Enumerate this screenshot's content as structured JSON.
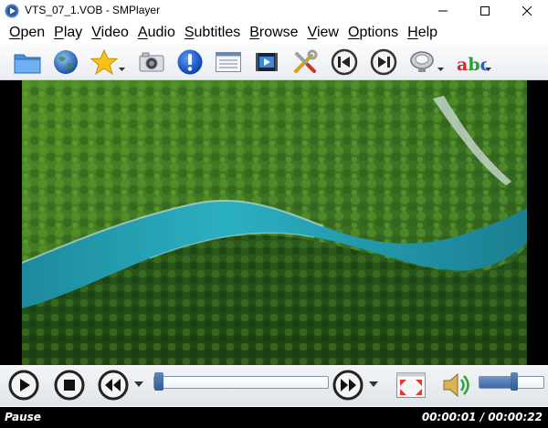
{
  "window": {
    "title": "VTS_07_1.VOB - SMPlayer",
    "minimize_glyph": "—",
    "maximize_glyph": "☐",
    "close_glyph": "✕"
  },
  "menu": [
    {
      "first": "O",
      "rest": "pen"
    },
    {
      "first": "P",
      "rest": "lay"
    },
    {
      "first": "V",
      "rest": "ideo"
    },
    {
      "first": "A",
      "rest": "udio"
    },
    {
      "first": "S",
      "rest": "ubtitles"
    },
    {
      "first": "B",
      "rest": "rowse"
    },
    {
      "first": "V",
      "rest": "iew"
    },
    {
      "first": "O",
      "rest": "ptions"
    },
    {
      "first": "H",
      "rest": "elp"
    }
  ],
  "toolbar": {
    "icons": [
      "folder-icon",
      "globe-icon",
      "star-icon",
      "camera-icon",
      "info-icon",
      "playlist-icon",
      "video-settings-icon",
      "tools-icon",
      "previous-icon",
      "next-icon",
      "eq-icon",
      "subtitles-icon"
    ],
    "abc_text": "abc"
  },
  "controls": {
    "play_state": "paused",
    "seek_fraction": 0.0,
    "volume_fraction": 0.55
  },
  "status": {
    "state": "Pause",
    "current_time": "00:00:01",
    "separator": "/",
    "total_time": "00:00:22"
  },
  "colors": {
    "accent": "#2f5b94",
    "river": "#2aa7b8",
    "forest": "#3e7a22",
    "statusbar_bg": "#000000"
  }
}
